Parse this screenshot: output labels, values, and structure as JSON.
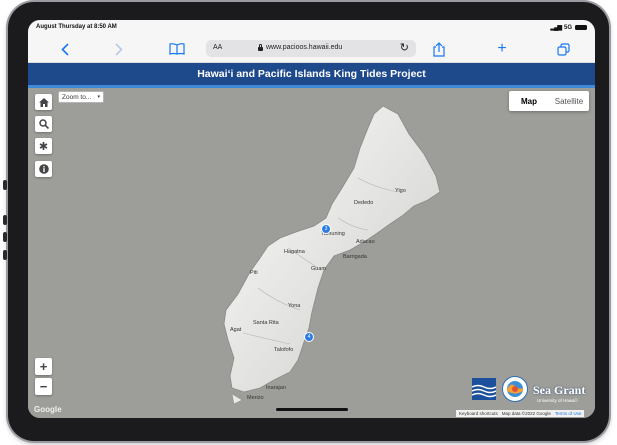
{
  "status_bar": {
    "time": "August Thursday at 8:50 AM",
    "network": "5G"
  },
  "browser": {
    "text_size_label": "AA",
    "url": "www.pacioos.hawaii.edu",
    "icons": [
      "back-icon",
      "forward-icon",
      "bookmarks-icon",
      "reload-icon",
      "share-icon",
      "new-tab-icon",
      "tabs-icon"
    ]
  },
  "banner": {
    "title": "Hawaiʻi and Pacific Islands King Tides Project",
    "color": "#1e4a8c"
  },
  "map_controls": {
    "zoom_to_label": "Zoom to...",
    "map_type_options": [
      "Map",
      "Satellite"
    ],
    "map_type_selected": "Map",
    "zoom_in": "+",
    "zoom_out": "−"
  },
  "map": {
    "place_labels": [
      "Yigo",
      "Dededo",
      "Tamuning",
      "Adacao",
      "Hagatna",
      "Barrigada",
      "Guam",
      "Piti",
      "Yona",
      "Santa Rita",
      "Agat",
      "Talofofo",
      "Inarajan",
      "Merizo"
    ],
    "markers": [
      "3",
      "4"
    ],
    "google_label": "Google",
    "attribution": {
      "shortcuts": "Keyboard shortcuts",
      "data": "Map data ©2022 Google",
      "terms": "Terms of Use"
    }
  },
  "logos": {
    "sea_grant": "Sea Grant",
    "sea_grant_sub": "University of Hawaiʻi"
  }
}
